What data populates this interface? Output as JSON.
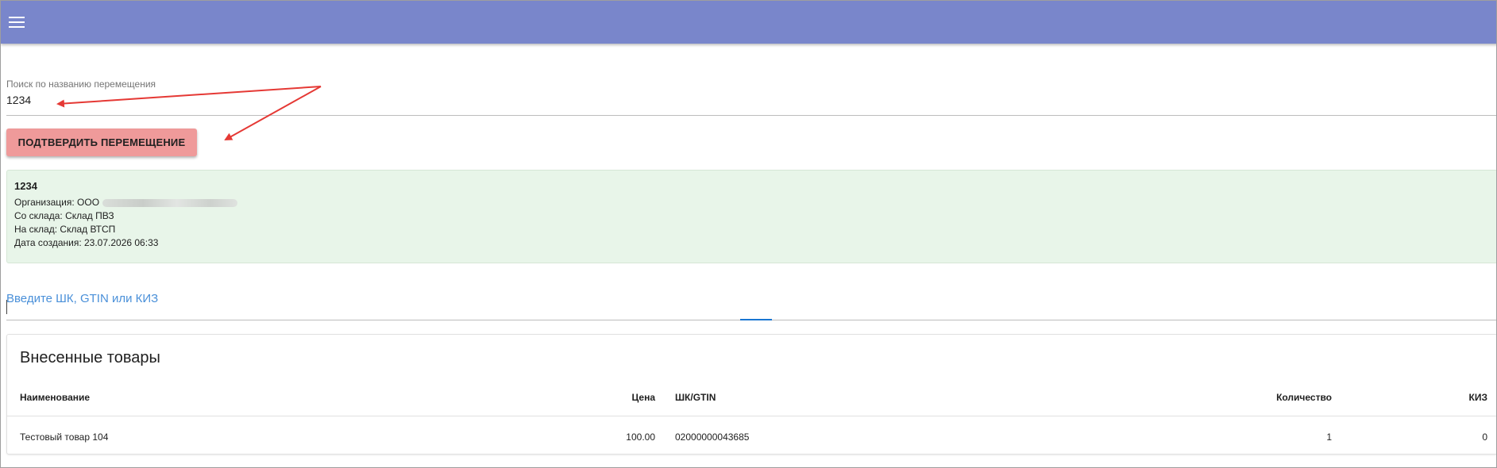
{
  "app_bar": {
    "color": "#7986cb"
  },
  "search": {
    "label": "Поиск по названию перемещения",
    "value": "1234"
  },
  "confirm_button": {
    "label": "ПОДТВЕРДИТЬ ПЕРЕМЕЩЕНИЕ",
    "color": "#ef9a9a"
  },
  "transfer": {
    "title": "1234",
    "organization_label": "Организация: ООО",
    "from_warehouse": "Со склада: Склад ПВЗ",
    "to_warehouse": "На склад: Склад ВТСП",
    "created": "Дата создания: 23.07.2026 06:33",
    "card_color": "#e8f5e9"
  },
  "barcode": {
    "label": "Введите ШК, GTIN или КИЗ",
    "label_color": "#4a90d9"
  },
  "products": {
    "title": "Внесенные товары",
    "columns": {
      "name": "Наименование",
      "price": "Цена",
      "gtin": "ШК/GTIN",
      "qty": "Количество",
      "kiz": "КИЗ"
    },
    "rows": [
      {
        "name": "Тестовый товар 104",
        "price": "100.00",
        "gtin": "02000000043685",
        "qty": "1",
        "kiz": "0"
      }
    ]
  },
  "annotation_color": "#e53935"
}
